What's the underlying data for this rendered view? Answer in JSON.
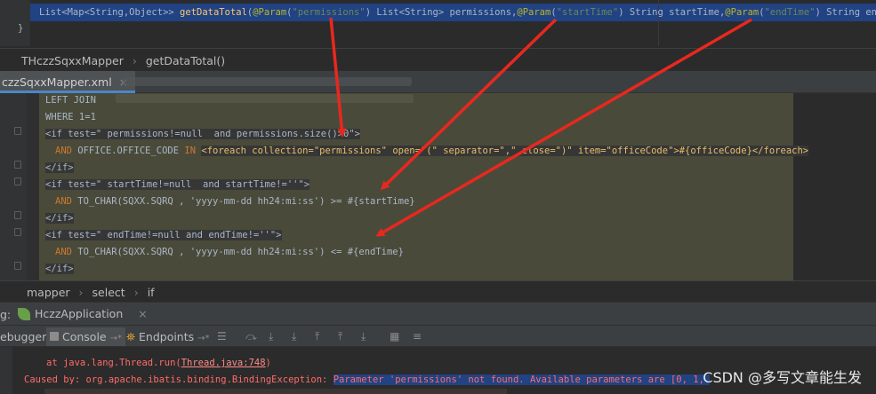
{
  "java": {
    "signature_before": "List<Map<String,Object>> ",
    "method": "getDataTotal",
    "paren_open": "(",
    "ann": "@Param",
    "p1_str": "\"permissions\"",
    "p1_rest": ") List<String> permissions,",
    "p2_str": "\"startTime\"",
    "p2_rest": ") String startTime,",
    "p3_str": "\"endTime\"",
    "p3_rest": ") String endTime);",
    "closing_brace": "}"
  },
  "java_breadcrumb": {
    "class_name": "THczzSqxxMapper",
    "method_name": "getDataTotal()"
  },
  "tab": {
    "label": "czzSqxxMapper.xml",
    "close": "×"
  },
  "xml": {
    "line1": "LEFT JOIN",
    "line2": "WHERE 1=1",
    "if1_open": "<if test=\" permissions!=null  and permissions.size()>0\">",
    "line4_and": "AND",
    "line4_code": " OFFICE.OFFICE_CODE ",
    "line4_in": "IN",
    "line4_foreach": "<foreach collection=\"permissions\" open=\"(\" separator=\",\" close=\")\" item=\"officeCode\">#{officeCode}</foreach>",
    "if_close": "</if>",
    "if2_open": "<if test=\" startTime!=null  and startTime!=''\">",
    "line7_and": "AND",
    "line7_code": " TO_CHAR(SQXX.SQRQ , 'yyyy-mm-dd hh24:mi:ss') >= #{startTime}",
    "if3_open": "<if test=\" endTime!=null and endTime!=''\">",
    "line10_and": "AND",
    "line10_code": " TO_CHAR(SQXX.SQRQ , 'yyyy-mm-dd hh24:mi:ss') <= #{endTime}"
  },
  "xml_breadcrumb": [
    "mapper",
    "select",
    "if"
  ],
  "run_bar": {
    "label": "g:",
    "app_name": "HczzApplication",
    "close": "×"
  },
  "console_toolbar": {
    "debugger_tab": "ebugger",
    "console_tab": "Console",
    "console_suffix": "→*",
    "endpoints_tab": "Endpoints",
    "endpoints_suffix": "→*"
  },
  "console": {
    "line1_prefix": "at java.lang.Thread.run(",
    "line1_link": "Thread.java:748",
    "line1_suffix": ")",
    "line2_prefix": "Caused by: org.apache.ibatis.binding.BindingException: ",
    "line2_selected": "Parameter 'permissions' not found. Available parameters are [0, 1, "
  },
  "watermark": "CSDN @多写文章能生发",
  "colors": {
    "editor_bg": "#2b2b2b",
    "selection": "#214283",
    "arrow": "#e8281e",
    "error_text": "#ff6b68"
  }
}
